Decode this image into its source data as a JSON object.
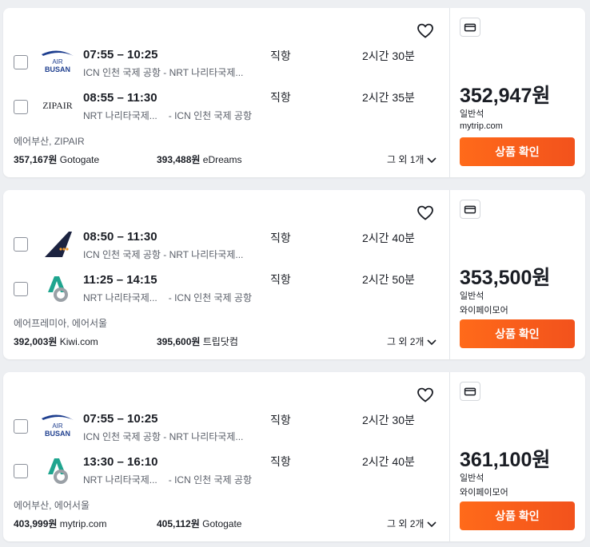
{
  "cards": [
    {
      "legs": [
        {
          "airline_logo": "air-busan-logo",
          "logo_text": [
            "AIR",
            "BUSAN"
          ],
          "times": "07:55 – 10:25",
          "route": [
            "ICN 인천 국제 공항",
            "- NRT 나리타국제..."
          ],
          "stops": "직항",
          "duration": "2시간 30분"
        },
        {
          "airline_logo": "zipair-logo",
          "logo_text": [
            "ZIPAIR"
          ],
          "times": "08:55 – 11:30",
          "route": [
            "NRT 나리타국제...",
            "- ICN 인천 국제 공항"
          ],
          "stops": "직항",
          "duration": "2시간 35분"
        }
      ],
      "airlines": "에어부산, ZIPAIR",
      "other_prices": [
        {
          "price": "357,167원",
          "provider": "Gotogate"
        },
        {
          "price": "393,488원",
          "provider": "eDreams"
        }
      ],
      "more": "그 외 1개",
      "price": "352,947원",
      "cabin": "일반석",
      "provider": "mytrip.com",
      "cta": "상품 확인"
    },
    {
      "legs": [
        {
          "airline_logo": "air-premia-logo",
          "logo_text": [],
          "times": "08:50 – 11:30",
          "route": [
            "ICN 인천 국제 공항",
            "- NRT 나리타국제..."
          ],
          "stops": "직항",
          "duration": "2시간 40분"
        },
        {
          "airline_logo": "air-seoul-logo",
          "logo_text": [],
          "times": "11:25 – 14:15",
          "route": [
            "NRT 나리타국제...",
            "- ICN 인천 국제 공항"
          ],
          "stops": "직항",
          "duration": "2시간 50분"
        }
      ],
      "airlines": "에어프레미아, 에어서울",
      "other_prices": [
        {
          "price": "392,003원",
          "provider": "Kiwi.com"
        },
        {
          "price": "395,600원",
          "provider": "트립닷컴"
        }
      ],
      "more": "그 외 2개",
      "price": "353,500원",
      "cabin": "일반석",
      "provider": "와이페이모어",
      "cta": "상품 확인"
    },
    {
      "legs": [
        {
          "airline_logo": "air-busan-logo",
          "logo_text": [
            "AIR",
            "BUSAN"
          ],
          "times": "07:55 – 10:25",
          "route": [
            "ICN 인천 국제 공항",
            "- NRT 나리타국제..."
          ],
          "stops": "직항",
          "duration": "2시간 30분"
        },
        {
          "airline_logo": "air-seoul-logo",
          "logo_text": [],
          "times": "13:30 – 16:10",
          "route": [
            "NRT 나리타국제...",
            "- ICN 인천 국제 공항"
          ],
          "stops": "직항",
          "duration": "2시간 40분"
        }
      ],
      "airlines": "에어부산, 에어서울",
      "other_prices": [
        {
          "price": "403,999원",
          "provider": "mytrip.com"
        },
        {
          "price": "405,112원",
          "provider": "Gotogate"
        }
      ],
      "more": "그 외 2개",
      "price": "361,100원",
      "cabin": "일반석",
      "provider": "와이페이모어",
      "cta": "상품 확인"
    }
  ],
  "colors": {
    "accent": "#f2521c",
    "air_busan_blue": "#1f3f8f",
    "air_premia_navy": "#1c2340",
    "air_premia_orange": "#f39a2b",
    "air_seoul_teal": "#1fa58f"
  }
}
